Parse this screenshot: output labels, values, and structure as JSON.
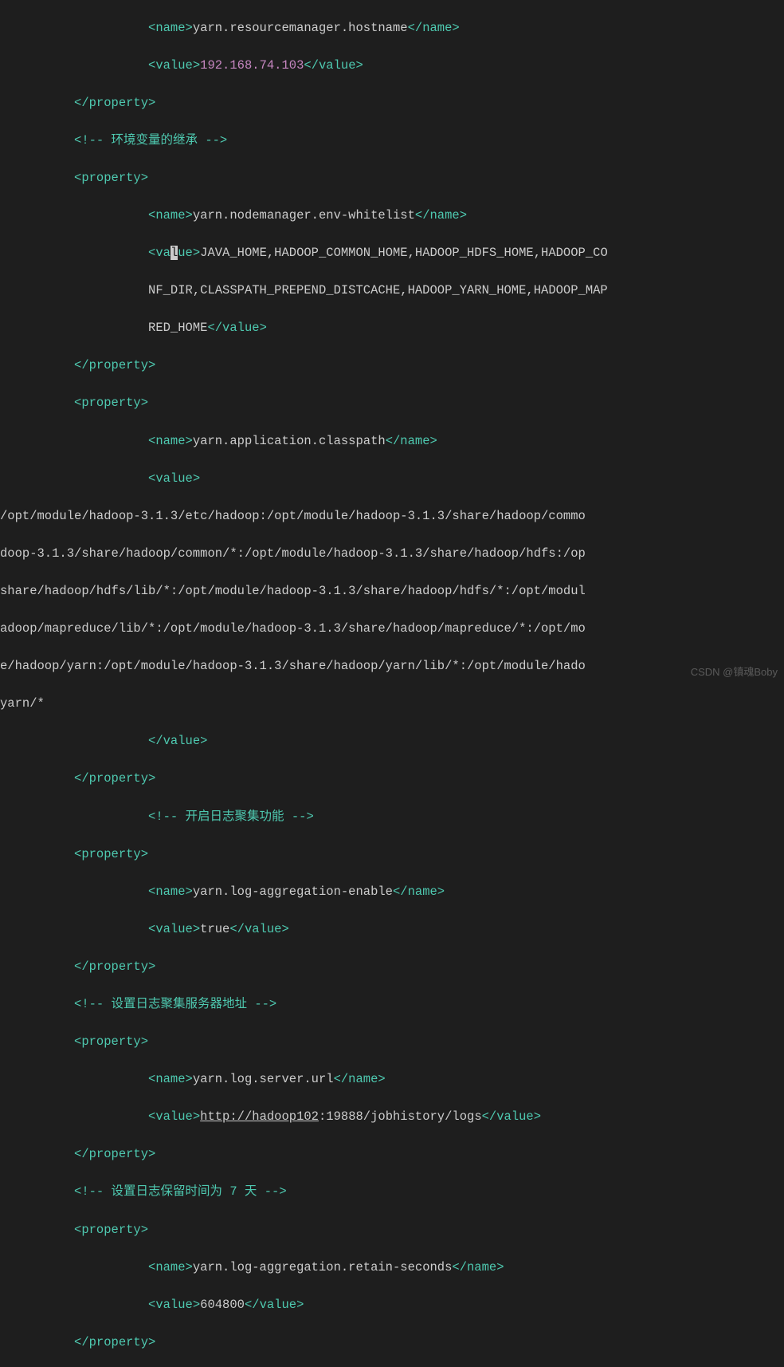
{
  "code": {
    "indent10": "          ",
    "indent20": "                    ",
    "open_name": "<name>",
    "close_name": "</name>",
    "open_value": "<value>",
    "open_va": "<va",
    "lue_close": "lue>",
    "close_value": "</value>",
    "open_property": "<property>",
    "close_property": "</property>",
    "prop1_name": "yarn.resourcemanager.hostname",
    "prop1_value": "192.168.74.103",
    "comment1": "<!-- 环境变量的继承 -->",
    "prop2_name": "yarn.nodemanager.env-whitelist",
    "prop2_value_l1": "JAVA_HOME,HADOOP_COMMON_HOME,HADOOP_HDFS_HOME,HADOOP_CO",
    "prop2_value_l2": "NF_DIR,CLASSPATH_PREPEND_DISTCACHE,HADOOP_YARN_HOME,HADOOP_MAP",
    "prop2_value_l3": "RED_HOME",
    "prop3_name": "yarn.application.classpath",
    "classpath_l1": "/opt/module/hadoop-3.1.3/etc/hadoop:/opt/module/hadoop-3.1.3/share/hadoop/commo",
    "classpath_l2": "doop-3.1.3/share/hadoop/common/*:/opt/module/hadoop-3.1.3/share/hadoop/hdfs:/op",
    "classpath_l3": "share/hadoop/hdfs/lib/*:/opt/module/hadoop-3.1.3/share/hadoop/hdfs/*:/opt/modul",
    "classpath_l4": "adoop/mapreduce/lib/*:/opt/module/hadoop-3.1.3/share/hadoop/mapreduce/*:/opt/mo",
    "classpath_l5": "e/hadoop/yarn:/opt/module/hadoop-3.1.3/share/hadoop/yarn/lib/*:/opt/module/hado",
    "classpath_l6": "yarn/*",
    "comment2": "<!-- 开启日志聚集功能 -->",
    "prop4_name": "yarn.log-aggregation-enable",
    "prop4_value": "true",
    "comment3": "<!-- 设置日志聚集服务器地址 -->",
    "prop5_name": "yarn.log.server.url",
    "prop5_url": "http://hadoop102",
    "prop5_rest": ":19888/jobhistory/logs",
    "comment4": "<!-- 设置日志保留时间为 7 天 -->",
    "prop6_name": "yarn.log-aggregation.retain-seconds",
    "prop6_value": "604800"
  },
  "watermark": "CSDN @镇魂Boby"
}
